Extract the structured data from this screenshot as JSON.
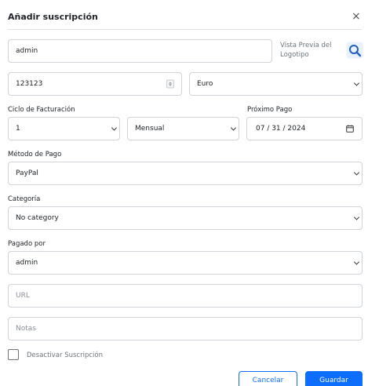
{
  "modal": {
    "title": "Añadir suscripción",
    "close_symbol": "×"
  },
  "form": {
    "name_value": "admin",
    "logo_preview_label": "Vista Previa del Logotipo",
    "price_value": "123123",
    "currency_selected": "Euro",
    "billing_cycle_label": "Ciclo de Facturación",
    "billing_cycle_number": "1",
    "billing_cycle_period": "Mensual",
    "next_payment_label": "Próximo Pago",
    "next_payment_value": "07 / 31 / 2024",
    "payment_method_label": "Método de Pago",
    "payment_method_selected": "PayPal",
    "category_label": "Categoría",
    "category_selected": "No category",
    "paid_by_label": "Pagado por",
    "paid_by_selected": "admin",
    "url_placeholder": "URL",
    "notes_placeholder": "Notas",
    "disable_label": "Desactivar Suscripción",
    "disable_checked": false
  },
  "buttons": {
    "cancel_label": "Cancelar",
    "save_label": "Guardar"
  },
  "colors": {
    "accent": "#0d6efd",
    "border": "#ced4da"
  },
  "icons": {
    "logo_search": "search-icon",
    "calendar": "calendar-icon",
    "close": "close-icon"
  }
}
